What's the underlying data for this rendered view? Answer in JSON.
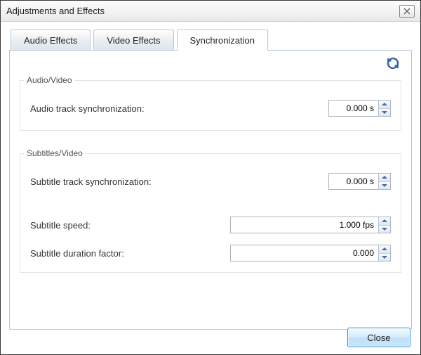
{
  "window": {
    "title": "Adjustments and Effects"
  },
  "tabs": {
    "audio_effects": "Audio Effects",
    "video_effects": "Video Effects",
    "synchronization": "Synchronization"
  },
  "sync": {
    "audio_video_group": "Audio/Video",
    "audio_track_sync_label": "Audio track synchronization:",
    "audio_track_sync_value": "0.000 s",
    "subtitles_video_group": "Subtitles/Video",
    "subtitle_track_sync_label": "Subtitle track synchronization:",
    "subtitle_track_sync_value": "0.000 s",
    "subtitle_speed_label": "Subtitle speed:",
    "subtitle_speed_value": "1.000 fps",
    "subtitle_duration_factor_label": "Subtitle duration factor:",
    "subtitle_duration_factor_value": "0.000"
  },
  "footer": {
    "close": "Close"
  },
  "icons": {
    "refresh": "refresh-icon",
    "window_close": "window-close-icon"
  }
}
